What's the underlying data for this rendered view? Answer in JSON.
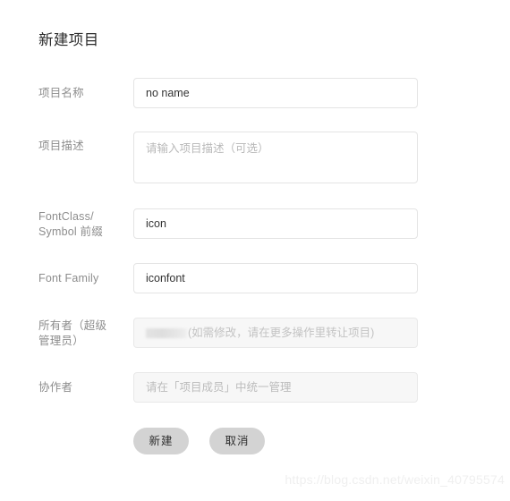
{
  "form": {
    "title": "新建项目",
    "rows": [
      {
        "label": "项目名称",
        "type": "input",
        "value": "no name",
        "placeholder": ""
      },
      {
        "label": "项目描述",
        "type": "textarea",
        "value": "",
        "placeholder": "请输入项目描述（可选）"
      },
      {
        "label_line1": "FontClass/",
        "label_line2": "Symbol 前缀",
        "type": "input",
        "value": "icon",
        "placeholder": ""
      },
      {
        "label": "Font Family",
        "type": "input",
        "value": "iconfont",
        "placeholder": ""
      },
      {
        "label_line1": "所有者（超级",
        "label_line2": "管理员）",
        "type": "owner",
        "redacted_name": "",
        "hint": "(如需修改，请在更多操作里转让项目)"
      },
      {
        "label": "协作者",
        "type": "input-disabled",
        "value": "",
        "placeholder": "请在「项目成员」中统一管理"
      }
    ],
    "buttons": {
      "submit_label": "新建",
      "cancel_label": "取消"
    }
  },
  "watermark": {
    "text": "https://blog.csdn.net/weixin_40795574"
  },
  "colors": {
    "page_background": "#ffffff",
    "label_text": "#8d8d8d",
    "value_text": "#333333",
    "placeholder_text": "#bcbcbc",
    "field_border": "#e4e4e4",
    "disabled_field_background": "#f7f7f7",
    "button_background": "#d3d3d3",
    "button_text": "#2f2f2f",
    "title_text": "#2b2b2b",
    "watermark_text": "#efefef"
  }
}
